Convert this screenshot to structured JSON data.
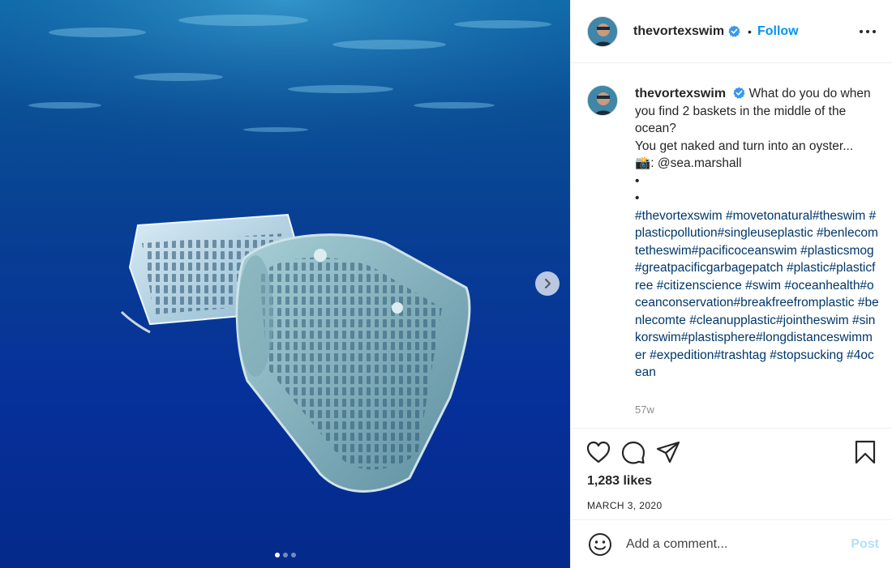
{
  "post": {
    "username": "thevortexswim",
    "follow_label": "Follow",
    "separator": "•",
    "caption": {
      "first_line": "What do you do when you find 2 baskets in the middle of the ocean?",
      "second_line": "You get naked and turn into an oyster...",
      "photo_credit": "📸: @sea.marshall",
      "bullet_1": "•",
      "bullet_2": "•",
      "hashtags": "#thevortexswim #movetonatural#theswim #plasticpollution#singleuseplastic #benlecomtetheswim#pacificoceanswim #plasticsmog#greatpacificgarbagepatch #plastic#plasticfree #citizenscience #swim #oceanhealth#oceanconservation#breakfreefromplastic #benlecomte #cleanupplastic#jointheswim #sinkorswim#plastisphere#longdistanceswimmer #expedition#trashtag #stopsucking #4ocean"
    },
    "time_ago": "57w",
    "likes": "1,283 likes",
    "date": "MARCH 3, 2020",
    "comment_placeholder": "Add a comment...",
    "post_label": "Post"
  },
  "carousel": {
    "total": 3,
    "current": 1
  },
  "colors": {
    "accent": "#0095f6",
    "post_disabled": "#b2dffc",
    "hashtag": "#00376b",
    "water_deep": "#042a8a"
  },
  "icons": {
    "verified": "verified-badge-icon",
    "more": "more-options-icon",
    "next": "chevron-right-icon",
    "like": "heart-icon",
    "comment": "comment-bubble-icon",
    "share": "paper-plane-icon",
    "save": "bookmark-icon",
    "emoji": "smiley-icon"
  }
}
